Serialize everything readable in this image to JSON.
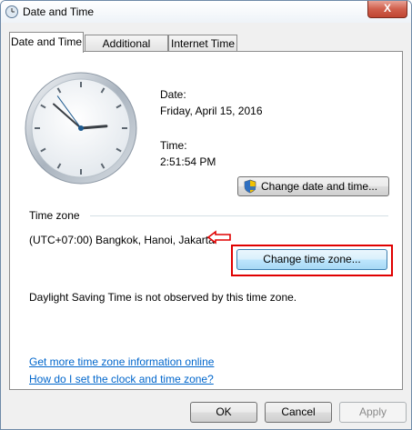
{
  "window": {
    "title": "Date and Time",
    "close_label": "X"
  },
  "tabs": [
    {
      "label": "Date and Time",
      "active": true
    },
    {
      "label": "Additional Clocks",
      "active": false
    },
    {
      "label": "Internet Time",
      "active": false
    }
  ],
  "datetime": {
    "date_label": "Date:",
    "date_value": "Friday, April 15, 2016",
    "time_label": "Time:",
    "time_value": "2:51:54 PM",
    "change_button": "Change date and time..."
  },
  "timezone": {
    "section_label": "Time zone",
    "value": "(UTC+07:00) Bangkok, Hanoi, Jakarta",
    "change_button": "Change time zone...",
    "dst_note": "Daylight Saving Time is not observed by this time zone."
  },
  "links": {
    "more_info": "Get more time zone information online",
    "how_to": "How do I set the clock and time zone?"
  },
  "footer": {
    "ok": "OK",
    "cancel": "Cancel",
    "apply": "Apply"
  },
  "colors": {
    "link": "#0066cc",
    "highlight": "#e00000",
    "close": "#c04531"
  },
  "clock": {
    "hour": 2,
    "minute": 51,
    "second": 54
  }
}
